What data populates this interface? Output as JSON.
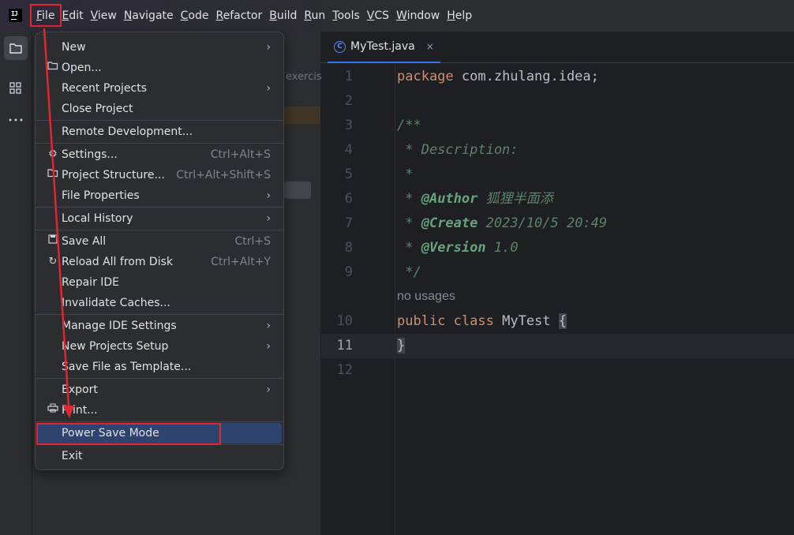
{
  "menubar": [
    "File",
    "Edit",
    "View",
    "Navigate",
    "Code",
    "Refactor",
    "Build",
    "Run",
    "Tools",
    "VCS",
    "Window",
    "Help"
  ],
  "app_logo_text": "IJ",
  "project_fragment": "exercis",
  "tab": {
    "name": "MyTest.java",
    "icon": "java-class-icon",
    "close": "×"
  },
  "code": {
    "line_numbers": [
      "1",
      "2",
      "3",
      "4",
      "5",
      "6",
      "7",
      "8",
      "9",
      "10",
      "11",
      "12"
    ],
    "l1_kw": "package",
    "l1_rest": " com.zhulang.idea;",
    "l3": "/**",
    "l4": " * Description:",
    "l5": " *",
    "l6_star": " * ",
    "l6_tag": "@Author",
    "l6_val": " 狐狸半面添",
    "l7_star": " * ",
    "l7_tag": "@Create",
    "l7_val": " 2023/10/5 20:49",
    "l8_star": " * ",
    "l8_tag": "@Version",
    "l8_val": " 1.0",
    "l9": " */",
    "inlay": "no usages",
    "l10_kw1": "public",
    "l10_kw2": "class",
    "l10_cls": "MyTest",
    "l10_brace": "{",
    "l11": "}"
  },
  "file_menu": {
    "new": "New",
    "open": "Open...",
    "recent": "Recent Projects",
    "close_project": "Close Project",
    "remote": "Remote Development...",
    "settings": "Settings...",
    "settings_sc": "Ctrl+Alt+S",
    "project_structure": "Project Structure...",
    "project_structure_sc": "Ctrl+Alt+Shift+S",
    "file_properties": "File Properties",
    "local_history": "Local History",
    "save_all": "Save All",
    "save_all_sc": "Ctrl+S",
    "reload": "Reload All from Disk",
    "reload_sc": "Ctrl+Alt+Y",
    "repair": "Repair IDE",
    "invalidate": "Invalidate Caches...",
    "manage_settings": "Manage IDE Settings",
    "new_projects_setup": "New Projects Setup",
    "save_template": "Save File as Template...",
    "export": "Export",
    "print": "Print...",
    "power_save": "Power Save Mode",
    "exit": "Exit",
    "submenu_arrow": "›"
  },
  "colors": {
    "annotation": "#e0262f",
    "selection": "#2e436e",
    "accent": "#3574f0"
  }
}
